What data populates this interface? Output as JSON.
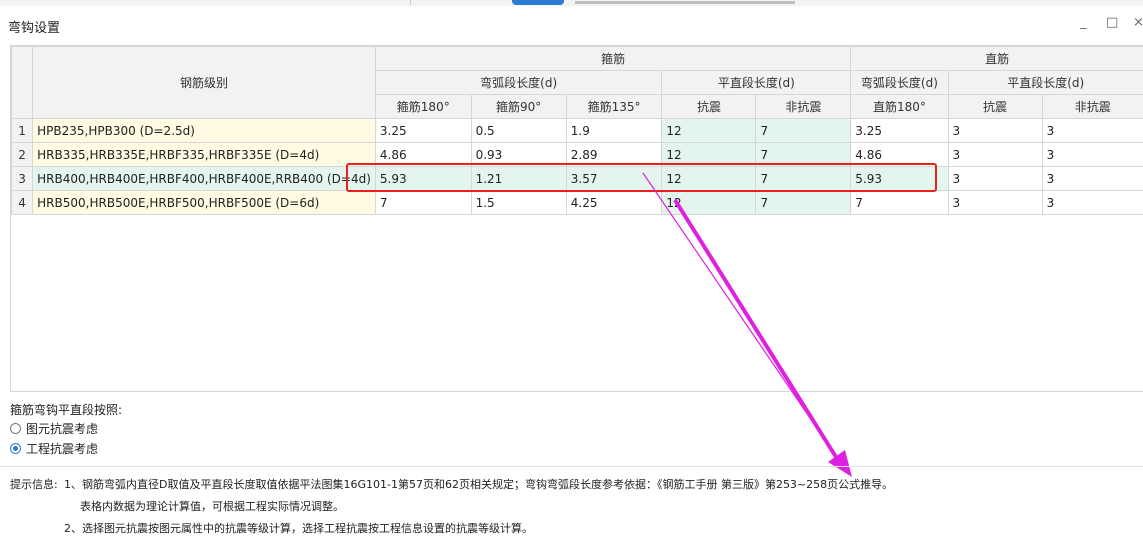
{
  "window": {
    "title": "弯钩设置",
    "minimize_glyph": "_",
    "maximize_glyph": "□",
    "close_glyph": "×"
  },
  "table": {
    "header_level": "钢筋级别",
    "group_stirrup": "箍筋",
    "group_straight": "直筋",
    "sub_arc_stirrup": "弯弧段长度(d)",
    "sub_flat_stirrup": "平直段长度(d)",
    "sub_arc_straight": "弯弧段长度(d)",
    "sub_flat_straight": "平直段长度(d)",
    "col_stirrup180": "箍筋180°",
    "col_stirrup90": "箍筋90°",
    "col_stirrup135": "箍筋135°",
    "col_seismic_1": "抗震",
    "col_nonseismic_1": "非抗震",
    "col_straight180": "直筋180°",
    "col_seismic_2": "抗震",
    "col_nonseismic_2": "非抗震",
    "rows": [
      {
        "n": "1",
        "level": "HPB235,HPB300 (D=2.5d)",
        "v": [
          "3.25",
          "0.5",
          "1.9",
          "12",
          "7",
          "3.25",
          "3",
          "3"
        ]
      },
      {
        "n": "2",
        "level": "HRB335,HRB335E,HRBF335,HRBF335E (D=4d)",
        "v": [
          "4.86",
          "0.93",
          "2.89",
          "12",
          "7",
          "4.86",
          "3",
          "3"
        ]
      },
      {
        "n": "3",
        "level": "HRB400,HRB400E,HRBF400,HRBF400E,RRB400 (D=4d)",
        "v": [
          "5.93",
          "1.21",
          "3.57",
          "12",
          "7",
          "5.93",
          "3",
          "3"
        ]
      },
      {
        "n": "4",
        "level": "HRB500,HRB500E,HRBF500,HRBF500E (D=6d)",
        "v": [
          "7",
          "1.5",
          "4.25",
          "12",
          "7",
          "7",
          "3",
          "3"
        ]
      }
    ]
  },
  "options": {
    "title": "箍筋弯钩平直段按照:",
    "radio1": "图元抗震考虑",
    "radio2": "工程抗震考虑",
    "selected": "工程抗震考虑"
  },
  "hint": {
    "label": "提示信息:",
    "line1": "1、钢筋弯弧内直径D取值及平直段长度取值依据平法图集16G101-1第57页和62页相关规定；弯钩弯弧段长度参考依据：《钢筋工手册 第三版》第253~258页公式推导。",
    "line2": "表格内数据为理论计算值，可根据工程实际情况调整。",
    "line3": "2、选择图元抗震按图元属性中的抗震等级计算，选择工程抗震按工程信息设置的抗震等级计算。"
  },
  "annotation_colors": {
    "highlight_box": "#e8201e",
    "arrow": "#e020e0"
  }
}
